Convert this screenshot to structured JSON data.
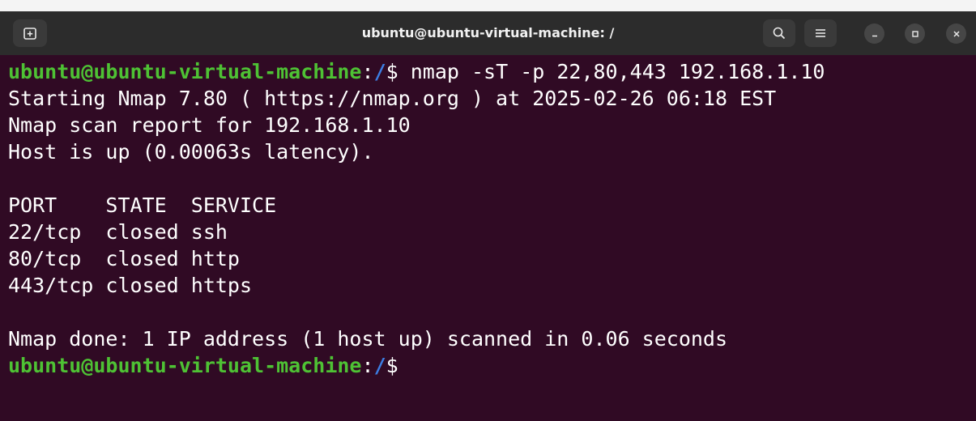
{
  "window": {
    "title": "ubuntu@ubuntu-virtual-machine: /"
  },
  "icons": {
    "new_tab": "new-tab-icon",
    "search": "search-icon",
    "menu": "hamburger-menu-icon",
    "minimize": "minimize-icon",
    "maximize": "maximize-icon",
    "close": "close-icon"
  },
  "colors": {
    "background": "#300a24",
    "prompt_user": "#4ec234",
    "prompt_path": "#3c7de2",
    "text": "#ffffff"
  },
  "terminal": {
    "prompt_user": "ubuntu@ubuntu-virtual-machine",
    "prompt_sep": ":",
    "prompt_path": "/",
    "prompt_symbol": "$",
    "command": " nmap -sT -p 22,80,443 192.168.1.10",
    "output": [
      "Starting Nmap 7.80 ( https://nmap.org ) at 2025-02-26 06:18 EST",
      "Nmap scan report for 192.168.1.10",
      "Host is up (0.00063s latency).",
      "",
      "PORT    STATE  SERVICE",
      "22/tcp  closed ssh",
      "80/tcp  closed http",
      "443/tcp closed https",
      "",
      "Nmap done: 1 IP address (1 host up) scanned in 0.06 seconds"
    ],
    "final_prompt_user": "ubuntu@ubuntu-virtual-machine",
    "final_prompt_sep": ":",
    "final_prompt_path": "/",
    "final_prompt_symbol": "$"
  }
}
